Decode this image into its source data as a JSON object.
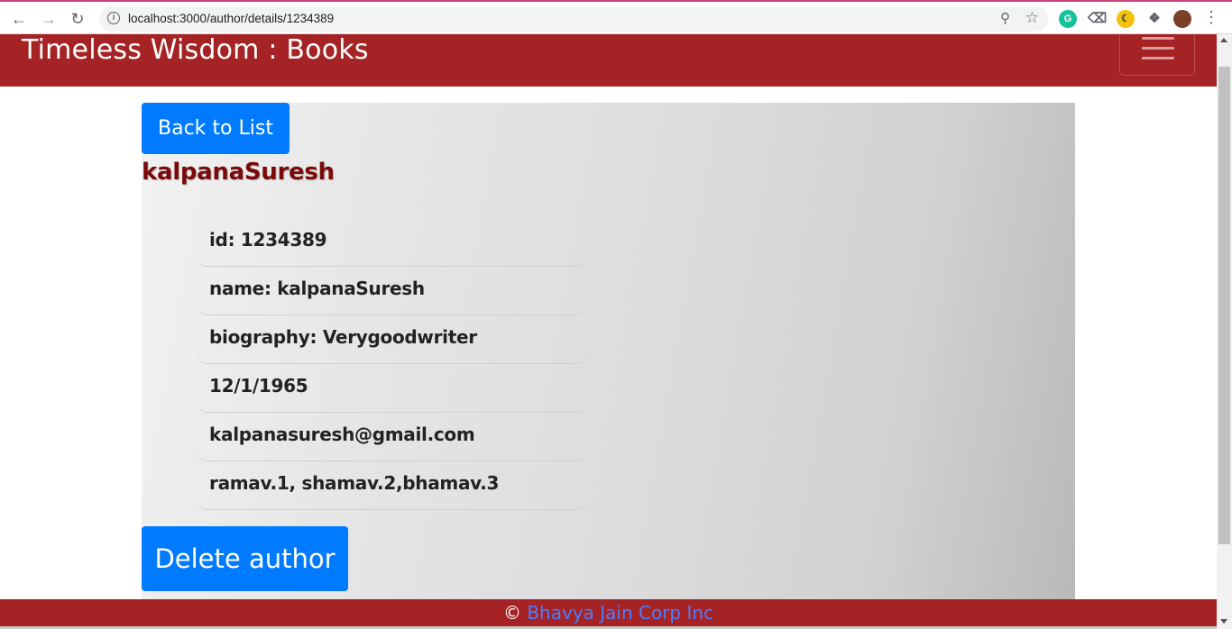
{
  "browser": {
    "url": "localhost:3000/author/details/1234389",
    "icons": [
      "back-arrow-icon",
      "forward-arrow-icon",
      "reload-icon",
      "info-icon",
      "zoom-icon",
      "star-icon",
      "grammarly-icon",
      "eraser-icon",
      "moon-icon",
      "puzzle-icon",
      "avatar",
      "more-menu-icon"
    ]
  },
  "navbar": {
    "brand": "Timeless Wisdom : Books",
    "bg_color": "#a52325"
  },
  "main": {
    "back_button": "Back to List",
    "author_heading": "kalpanaSuresh",
    "details": [
      {
        "text": "id: 1234389"
      },
      {
        "text": "name: kalpanaSuresh"
      },
      {
        "text": "biography: Verygoodwriter"
      },
      {
        "text": "12/1/1965"
      },
      {
        "text": "kalpanasuresh@gmail.com"
      },
      {
        "text": "ramav.1, shamav.2,bhamav.3"
      }
    ],
    "delete_button": "Delete author",
    "button_color": "#007bff"
  },
  "footer": {
    "copyright_symbol": "©",
    "company_link": "Bhavya Jain Corp Inc"
  }
}
